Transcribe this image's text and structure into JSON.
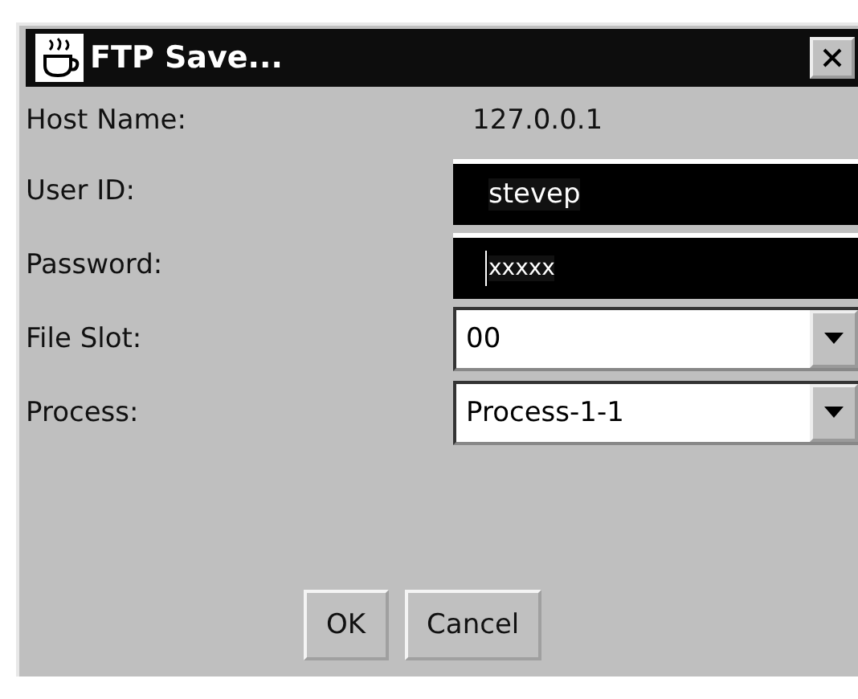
{
  "window": {
    "title": "FTP Save..."
  },
  "fields": [
    {
      "label": "Host Name:",
      "kind": "static",
      "value": "127.0.0.1"
    },
    {
      "label": "User ID:",
      "kind": "text",
      "value": "stevep",
      "focused": false
    },
    {
      "label": "Password:",
      "kind": "text",
      "value": "xxxxx",
      "focused": true
    },
    {
      "label": "File Slot:",
      "kind": "dropdown",
      "value": "00"
    },
    {
      "label": "Process:",
      "kind": "dropdown",
      "value": "Process-1-1"
    }
  ],
  "buttons": [
    "OK",
    "Cancel"
  ]
}
